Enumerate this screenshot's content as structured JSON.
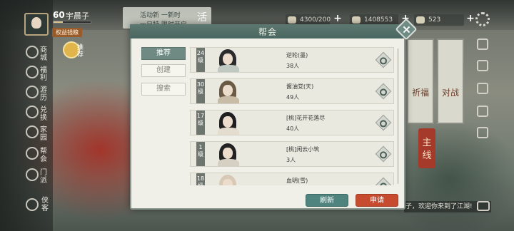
{
  "player": {
    "level": "60",
    "name": "宇晨子",
    "vip_label": "权益钱粮",
    "xp_fraction": 0.25
  },
  "event_ribbon": {
    "line1": "活动新 一新时",
    "line2": "一日特 限时开启",
    "big_char": "活"
  },
  "resources": [
    {
      "icon": "silver-ingot-icon",
      "value": "4300/200"
    },
    {
      "icon": "copper-coin-icon",
      "value": "1408553"
    },
    {
      "icon": "jade-icon",
      "value": "523"
    }
  ],
  "left_menu": [
    {
      "icon": "shop-icon",
      "label": "商城"
    },
    {
      "icon": "welfare-icon",
      "label": "福利"
    },
    {
      "icon": "tour-icon",
      "label": "游历"
    },
    {
      "icon": "exchange-icon",
      "label": "兑换"
    },
    {
      "icon": "home-icon",
      "label": "家园"
    },
    {
      "icon": "guild-icon",
      "label": "帮会"
    },
    {
      "icon": "sect-icon",
      "label": "门派"
    }
  ],
  "beggar_label": "侠客",
  "recommend_badge": "推荐",
  "right_cards": [
    {
      "label": "祈福"
    },
    {
      "label": "对战"
    }
  ],
  "mainline_label": "主线",
  "chat_text": "子，欢迎你来到了江湖!",
  "modal": {
    "title": "帮会",
    "tabs": [
      "推荐",
      "创建",
      "搜索"
    ],
    "active_tab": 0,
    "guilds": [
      {
        "level_num": "24",
        "level_unit": "级",
        "name": "逆轮(墨)",
        "members": "38人",
        "hair": "#2b2b2b",
        "robe": "#bfc9c2"
      },
      {
        "level_num": "30",
        "level_unit": "级",
        "name": "酱油党(天)",
        "members": "49人",
        "hair": "#6b5a45",
        "robe": "#c8bca6"
      },
      {
        "level_num": "17",
        "level_unit": "级",
        "name": "[桃]花开花落尽",
        "members": "40人",
        "hair": "#1f1f1f",
        "robe": "#e4dccf"
      },
      {
        "level_num": "1",
        "level_unit": "级",
        "name": "[桃]闲云小筑",
        "members": "3人",
        "hair": "#222222",
        "robe": "#d6d0c2"
      },
      {
        "level_num": "18",
        "level_unit": "级",
        "name": "血明(雪)",
        "members": "",
        "hair": "#d7c9b5",
        "robe": "#c8c2b2"
      }
    ],
    "refresh_label": "刷新",
    "apply_label": "申请"
  }
}
